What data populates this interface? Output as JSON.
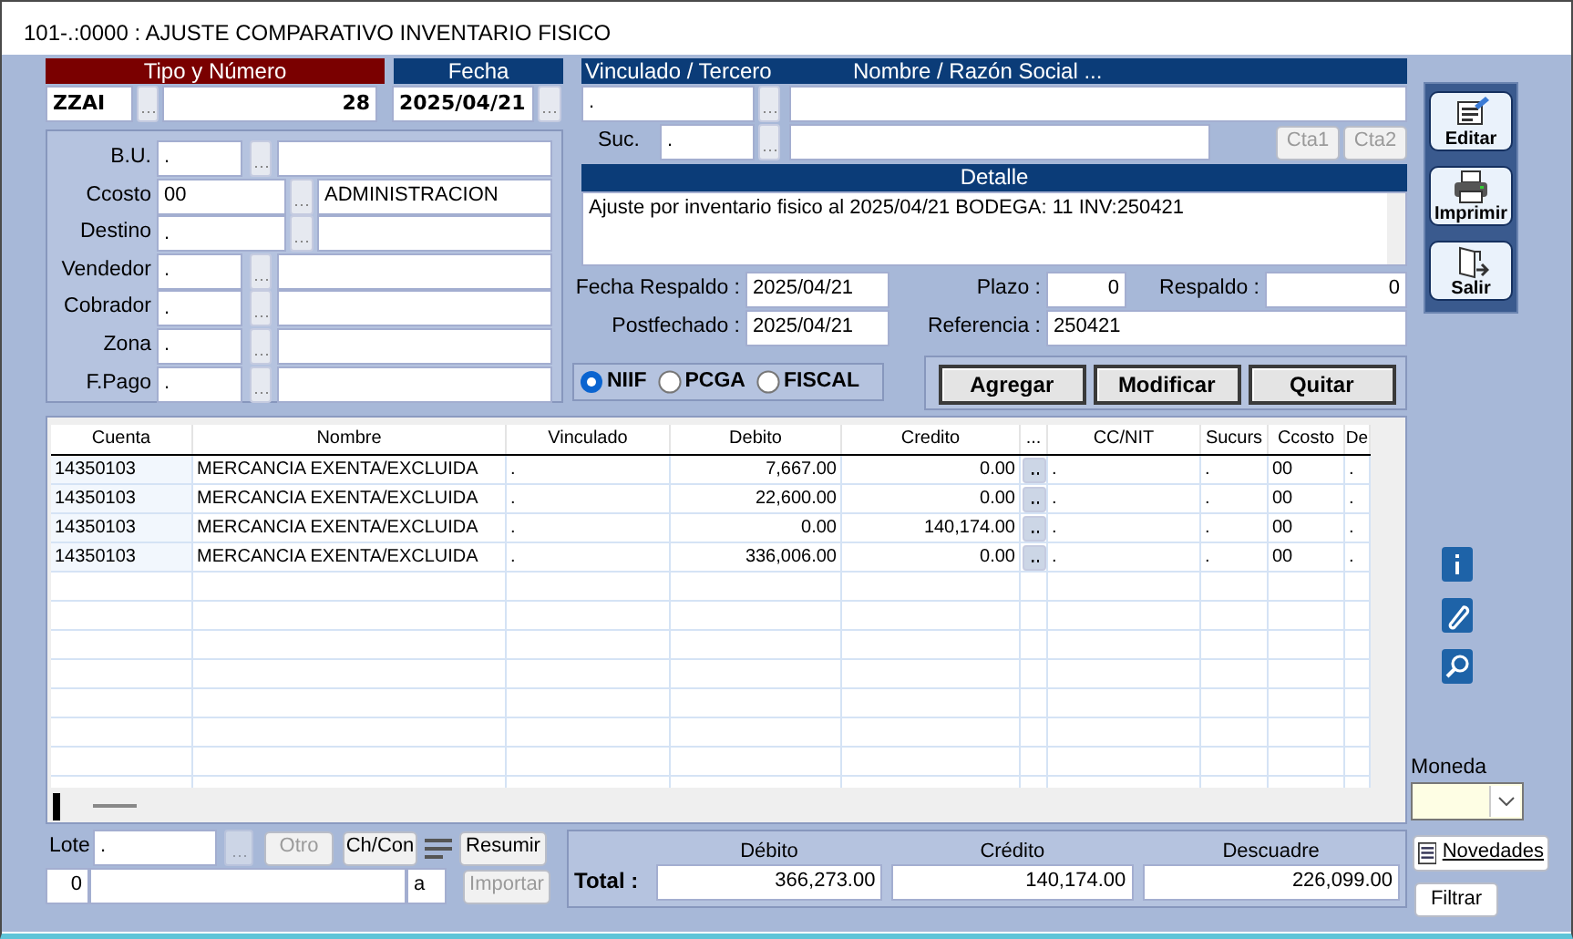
{
  "window": {
    "title": "101-.:0000 : AJUSTE COMPARATIVO INVENTARIO FISICO"
  },
  "tipo_numero": {
    "header": "Tipo y Número",
    "tipo": "ZZAI",
    "numero": "28"
  },
  "fecha": {
    "header": "Fecha",
    "value": "2025/04/21"
  },
  "lookup_fields": [
    {
      "label": "B.U.",
      "code": ".",
      "kind": "short"
    },
    {
      "label": "Ccosto",
      "code": "00",
      "description": "ADMINISTRACION",
      "kind": "wide"
    },
    {
      "label": "Destino",
      "code": ".",
      "kind": "wide"
    },
    {
      "label": "Vendedor",
      "code": ".",
      "kind": "short"
    },
    {
      "label": "Cobrador",
      "code": ".",
      "kind": "short"
    },
    {
      "label": "Zona",
      "code": ".",
      "kind": "short"
    },
    {
      "label": "F.Pago",
      "code": ".",
      "kind": "short"
    }
  ],
  "tercero": {
    "header_left": "Vinculado / Tercero",
    "header_right": "Nombre / Razón Social ...",
    "code": "."
  },
  "sucursal": {
    "label": "Suc.",
    "code": "."
  },
  "cuenta_buttons": [
    {
      "label": "Cta1",
      "disabled": true
    },
    {
      "label": "Cta2",
      "disabled": true
    }
  ],
  "detalle": {
    "header": "Detalle",
    "text": "Ajuste por inventario fisico al 2025/04/21 BODEGA: 11 INV:250421"
  },
  "fecha_respaldo": {
    "label": "Fecha Respaldo :",
    "value": "2025/04/21"
  },
  "postfechado": {
    "label": "Postfechado :",
    "value": "2025/04/21"
  },
  "plazo": {
    "label": "Plazo :",
    "value": "0"
  },
  "respaldo": {
    "label": "Respaldo :",
    "value": "0"
  },
  "referencia": {
    "label": "Referencia :",
    "value": "250421"
  },
  "norma": [
    {
      "label": "NIIF",
      "selected": true
    },
    {
      "label": "PCGA",
      "selected": false
    },
    {
      "label": "FISCAL",
      "selected": false
    }
  ],
  "actions": [
    "Agregar",
    "Modificar",
    "Quitar"
  ],
  "toolbar": [
    {
      "label": "Editar",
      "kind": "edit"
    },
    {
      "label": "Imprimir",
      "kind": "print"
    },
    {
      "label": "Salir",
      "kind": "exit"
    }
  ],
  "table": {
    "columns": [
      {
        "label": "Cuenta",
        "kind": "text"
      },
      {
        "label": "Nombre",
        "kind": "text"
      },
      {
        "label": "Vinculado",
        "kind": "text"
      },
      {
        "label": "Debito",
        "kind": "number"
      },
      {
        "label": "Credito",
        "kind": "number"
      },
      {
        "label": "...",
        "kind": "button"
      },
      {
        "label": "CC/NIT",
        "kind": "text"
      },
      {
        "label": "Sucurs",
        "kind": "text"
      },
      {
        "label": "Ccosto",
        "kind": "text"
      },
      {
        "label": "De",
        "kind": "text"
      }
    ],
    "rows": [
      [
        "14350103",
        "MERCANCIA EXENTA/EXCLUIDA",
        ".",
        "7,667.00",
        "0.00",
        "",
        ".",
        ".",
        "00",
        "."
      ],
      [
        "14350103",
        "MERCANCIA EXENTA/EXCLUIDA",
        ".",
        "22,600.00",
        "0.00",
        "",
        ".",
        ".",
        "00",
        "."
      ],
      [
        "14350103",
        "MERCANCIA EXENTA/EXCLUIDA",
        ".",
        "0.00",
        "140,174.00",
        "",
        ".",
        ".",
        "00",
        "."
      ],
      [
        "14350103",
        "MERCANCIA EXENTA/EXCLUIDA",
        ".",
        "336,006.00",
        "0.00",
        "",
        ".",
        ".",
        "00",
        "."
      ]
    ]
  },
  "moneda": {
    "label": "Moneda"
  },
  "side_buttons": [
    "Novedades",
    "Filtrar"
  ],
  "lote": {
    "label": "Lote",
    "value": ".",
    "number": "0",
    "suffix": "a"
  },
  "bottom_buttons": [
    {
      "label": "Otro",
      "disabled": true
    },
    {
      "label": "Ch/Con",
      "disabled": false
    },
    {
      "label": "Resumir",
      "disabled": false
    },
    {
      "label": "Importar",
      "disabled": true
    }
  ],
  "totals": {
    "label": "Total :",
    "columns": [
      {
        "header": "Débito",
        "value": "366,273.00"
      },
      {
        "header": "Crédito",
        "value": "140,174.00"
      },
      {
        "header": "Descuadre",
        "value": "226,099.00"
      }
    ]
  }
}
